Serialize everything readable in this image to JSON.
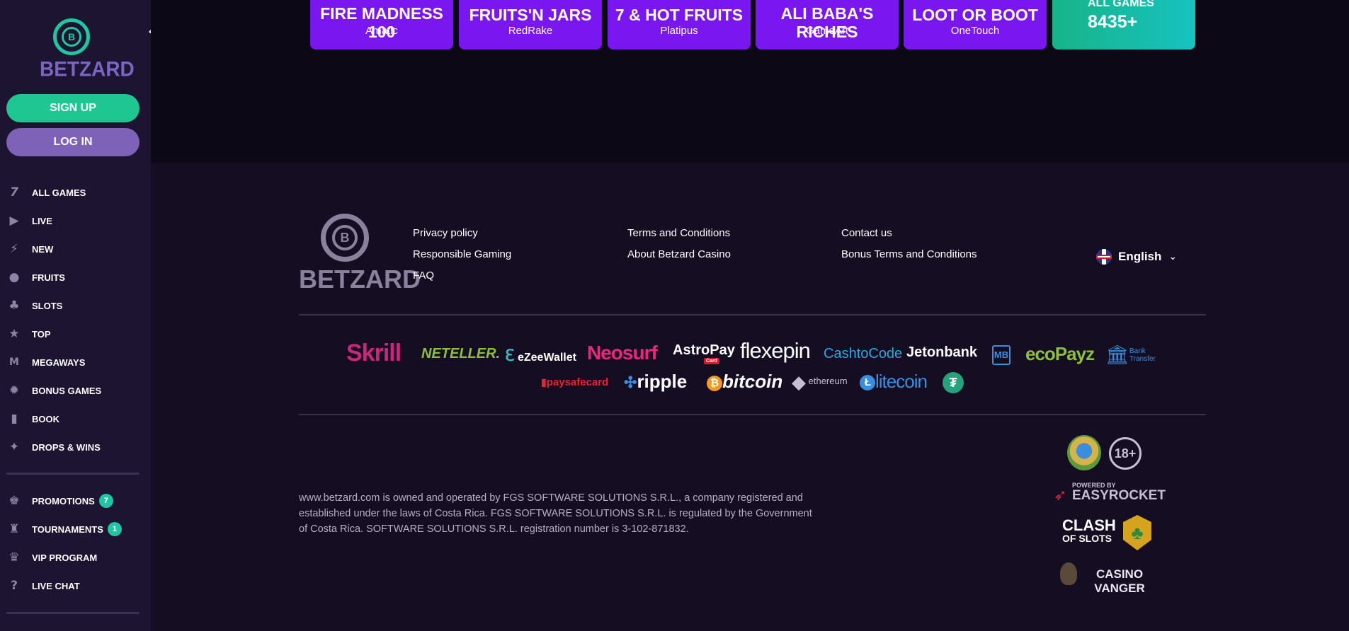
{
  "sidebar": {
    "brand": "BETZARD",
    "collapse_icon": "‹",
    "signup_label": "SIGN UP",
    "login_label": "LOG IN",
    "nav": [
      {
        "label": "ALL GAMES",
        "icon": "seven-icon"
      },
      {
        "label": "LIVE",
        "icon": "play-icon"
      },
      {
        "label": "NEW",
        "icon": "lightning-icon"
      },
      {
        "label": "FRUITS",
        "icon": "fruit-icon"
      },
      {
        "label": "SLOTS",
        "icon": "cherries-icon"
      },
      {
        "label": "TOP",
        "icon": "star-icon"
      },
      {
        "label": "MEGAWAYS",
        "icon": "megaways-icon"
      },
      {
        "label": "BONUS GAMES",
        "icon": "bonus-icon"
      },
      {
        "label": "BOOK",
        "icon": "book-icon"
      },
      {
        "label": "DROPS & WINS",
        "icon": "drops-icon"
      }
    ],
    "nav2": [
      {
        "label": "PROMOTIONS",
        "icon": "promotions-icon",
        "badge": "7"
      },
      {
        "label": "TOURNAMENTS",
        "icon": "trophy-icon",
        "badge": "1"
      },
      {
        "label": "VIP PROGRAM",
        "icon": "vip-icon"
      },
      {
        "label": "LIVE CHAT",
        "icon": "chat-icon"
      }
    ]
  },
  "games": [
    {
      "title": "FIRE MADNESS",
      "title2": "100",
      "provider": "Amatic"
    },
    {
      "title": "FRUITS'N JARS",
      "provider": "RedRake"
    },
    {
      "title": "7 & HOT FRUITS",
      "provider": "Platipus"
    },
    {
      "title": "ALI BABA'S",
      "title2": "RICHES",
      "provider": "GameArt"
    },
    {
      "title": "LOOT OR BOOT",
      "provider": "OneTouch"
    }
  ],
  "all_games": {
    "label": "ALL GAMES",
    "count": "8435+"
  },
  "footer": {
    "brand": "BETZARD",
    "links": {
      "privacy": "Privacy policy",
      "responsible": "Responsible Gaming",
      "faq": "FAQ",
      "terms": "Terms and Conditions",
      "about": "About Betzard Casino",
      "contact": "Contact us",
      "bonus_terms": "Bonus Terms and Conditions"
    },
    "language": "English",
    "payments": {
      "skrill": "Skrill",
      "neteller": "NETELLER.",
      "ezeewallet": "eZeeWallet",
      "neosurf": "Neosurf",
      "astropay": "AstroPay",
      "astropay_sub": "Card",
      "flexepin": "flexepin",
      "cashtocode": "CashtoCode",
      "jetonbank": "Jetonbank",
      "mb": "MB",
      "ecopayz": "ecoPayz",
      "bank_transfer": "Bank Transfer",
      "paysafecard": "paysafecard",
      "ripple": "ripple",
      "bitcoin": "bitcoin",
      "ethereum": "ethereum",
      "litecoin": "litecoin"
    },
    "disclaimer": "www.betzard.com is owned and operated by FGS SOFTWARE SOLUTIONS S.R.L., a company registered and established under the laws of Costa Rica. FGS SOFTWARE SOLUTIONS S.R.L. is regulated by the Government of Costa Rica. SOFTWARE SOLUTIONS S.R.L. registration number is 3-102-871832.",
    "age_badge": "18+",
    "powered_by": "POWERED BY",
    "easyrocket": "EASYROCKET",
    "clash1": "CLASH",
    "clash2": "OF SLOTS",
    "casino_vanger": "CASINO VANGER"
  },
  "colors": {
    "accent_green": "#1ec792",
    "accent_purple": "#7d62b7",
    "game_card": "#7a16f0"
  }
}
